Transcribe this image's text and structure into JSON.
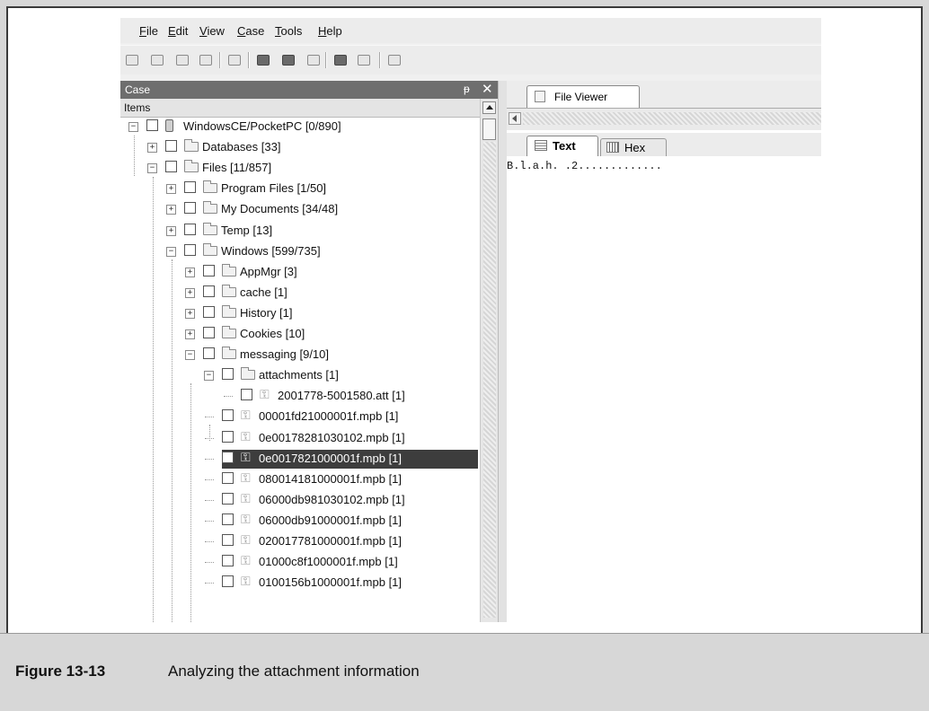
{
  "menu": [
    "File",
    "Edit",
    "View",
    "Case",
    "Tools",
    "Help"
  ],
  "toolbar_icons": [
    "new-icon",
    "open-icon",
    "save-icon",
    "undo-icon",
    "properties-icon",
    "search-icon",
    "find-icon",
    "bookmark-icon",
    "export-icon",
    "disabled-export-icon",
    "report-icon"
  ],
  "case_panel": {
    "title": "Case",
    "pin": "ᵽ",
    "close": "✕",
    "items_header": "Items"
  },
  "tree": [
    {
      "label": "WindowsCE/PocketPC [0/890]",
      "icon": "device",
      "expander": "−"
    },
    {
      "label": "Databases [33]",
      "icon": "folder",
      "expander": "+"
    },
    {
      "label": "Files [11/857]",
      "icon": "folder",
      "expander": "−"
    },
    {
      "label": "Program Files [1/50]",
      "icon": "folder",
      "expander": "+"
    },
    {
      "label": "My Documents [34/48]",
      "icon": "folder",
      "expander": "+"
    },
    {
      "label": "Temp [13]",
      "icon": "folder",
      "expander": "+"
    },
    {
      "label": "Windows [599/735]",
      "icon": "folder",
      "expander": "−"
    },
    {
      "label": "AppMgr [3]",
      "icon": "folder",
      "expander": "+"
    },
    {
      "label": "cache [1]",
      "icon": "folder",
      "expander": "+"
    },
    {
      "label": "History [1]",
      "icon": "folder",
      "expander": "+"
    },
    {
      "label": "Cookies [10]",
      "icon": "folder",
      "expander": "+"
    },
    {
      "label": "messaging [9/10]",
      "icon": "folder",
      "expander": "−"
    },
    {
      "label": "attachments [1]",
      "icon": "folder",
      "expander": "−"
    },
    {
      "label": "2001778-5001580.att [1]",
      "icon": "lock",
      "expander": ""
    },
    {
      "label": "00001fd21000001f.mpb [1]",
      "icon": "lock",
      "expander": ""
    },
    {
      "label": "0e00178281030102.mpb [1]",
      "icon": "lock",
      "expander": ""
    },
    {
      "label": "0e0017821000001f.mpb [1]",
      "icon": "lock",
      "expander": "",
      "selected": true
    },
    {
      "label": "080014181000001f.mpb [1]",
      "icon": "lock",
      "expander": ""
    },
    {
      "label": "06000db981030102.mpb [1]",
      "icon": "lock",
      "expander": ""
    },
    {
      "label": "06000db91000001f.mpb [1]",
      "icon": "lock",
      "expander": ""
    },
    {
      "label": "020017781000001f.mpb [1]",
      "icon": "lock",
      "expander": ""
    },
    {
      "label": "01000c8f1000001f.mpb [1]",
      "icon": "lock",
      "expander": ""
    },
    {
      "label": "0100156b1000001f.mpb [1]",
      "icon": "lock",
      "expander": ""
    }
  ],
  "viewer": {
    "tab": "File Viewer",
    "subtabs": {
      "text": "Text",
      "hex": "Hex"
    },
    "content": "B.l.a.h. .2............."
  },
  "caption": {
    "number": "Figure 13-13",
    "text": "Analyzing the attachment information"
  }
}
